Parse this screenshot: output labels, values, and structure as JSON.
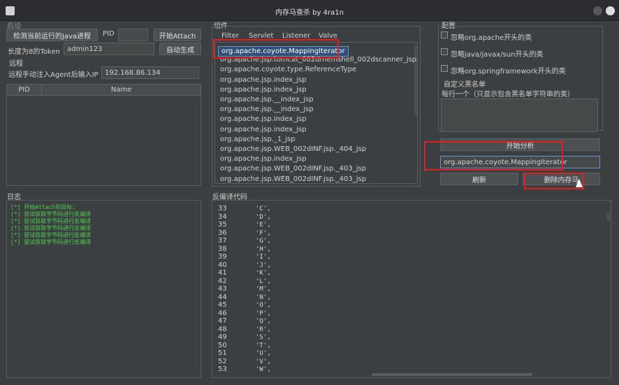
{
  "window": {
    "title": "内存马查杀 by 4ra1n"
  },
  "startup": {
    "label": "启动",
    "detect_button": "检测当前运行的Java进程",
    "pid_label": "PID",
    "pid_value": "",
    "attach_button": "开始Attach",
    "token_label": "长度为8的Token",
    "token_value": "admin123",
    "auto_generate_button": "自动生成"
  },
  "remote": {
    "label": "远程",
    "ip_label": "远程手动注入Agent后输入IP",
    "ip_value": "192.168.86.134"
  },
  "process_table": {
    "columns": [
      "PID",
      "Name"
    ],
    "rows": []
  },
  "components": {
    "label": "组件",
    "tabs": [
      "Filter",
      "Servlet",
      "Listener",
      "Valve"
    ],
    "items": [
      "org.apache.coyote.MappingIterator",
      "org.apache.jsp.tomcat_002dmemshell_002dscanner_jsp",
      "org.apache.coyote.type.ReferenceType",
      "org.apache.jsp.index_jsp",
      "org.apache.jsp.index_jsp",
      "org.apache.jsp.__index_jsp",
      "org.apache.jsp.__index_jsp",
      "org.apache.jsp.index_jsp",
      "org.apache.jsp.index_jsp",
      "org.apache.jsp._1_jsp",
      "org.apache.jsp.WEB_002dINF.jsp._404_jsp",
      "org.apache.jsp.index_jsp",
      "org.apache.jsp.WEB_002dINF.jsp._403_jsp",
      "org.apache.jsp.WEB_002dINF.jsp._403_jsp"
    ],
    "selected_index": 0
  },
  "config": {
    "label": "配置",
    "ignore_apache": "忽略org.apache开头的类",
    "ignore_java": "忽略java/javax/sun开头的类",
    "ignore_spring": "忽略org.springframework开头的类",
    "blacklist_label": "自定义黑名单",
    "blacklist_hint": "每行一个（只显示包含黑名单字符串的类）",
    "analyze_button": "开始分析",
    "class_field": "org.apache.coyote.MappingIterator",
    "refresh_button": "刷新",
    "delete_button": "删除内存马"
  },
  "log": {
    "label": "日志",
    "lines": [
      "[*] 开始Attach到目标:",
      "[*] 尝试获取字节码进行反编译",
      "[*] 尝试获取字节码进行反编译",
      "[*] 尝试获取字节码进行反编译",
      "[*] 尝试获取字节码进行反编译",
      "[*] 尝试获取字节码进行反编译"
    ]
  },
  "decompile": {
    "label": "反编译代码",
    "lines": [
      {
        "n": "33",
        "t": "'C',"
      },
      {
        "n": "34",
        "t": "'D',"
      },
      {
        "n": "35",
        "t": "'E',"
      },
      {
        "n": "36",
        "t": "'F',"
      },
      {
        "n": "37",
        "t": "'G',"
      },
      {
        "n": "38",
        "t": "'H',"
      },
      {
        "n": "39",
        "t": "'I',"
      },
      {
        "n": "40",
        "t": "'J',"
      },
      {
        "n": "41",
        "t": "'K',"
      },
      {
        "n": "42",
        "t": "'L',"
      },
      {
        "n": "43",
        "t": "'M',"
      },
      {
        "n": "44",
        "t": "'N',"
      },
      {
        "n": "45",
        "t": "'O',"
      },
      {
        "n": "46",
        "t": "'P',"
      },
      {
        "n": "47",
        "t": "'Q',"
      },
      {
        "n": "48",
        "t": "'R',"
      },
      {
        "n": "49",
        "t": "'S',"
      },
      {
        "n": "50",
        "t": "'T',"
      },
      {
        "n": "51",
        "t": "'U',"
      },
      {
        "n": "52",
        "t": "'V',"
      },
      {
        "n": "53",
        "t": "'W',"
      }
    ]
  },
  "colors": {
    "highlight": "#e02020",
    "log_text": "#4bd04b",
    "selection": "#2f4f78"
  }
}
